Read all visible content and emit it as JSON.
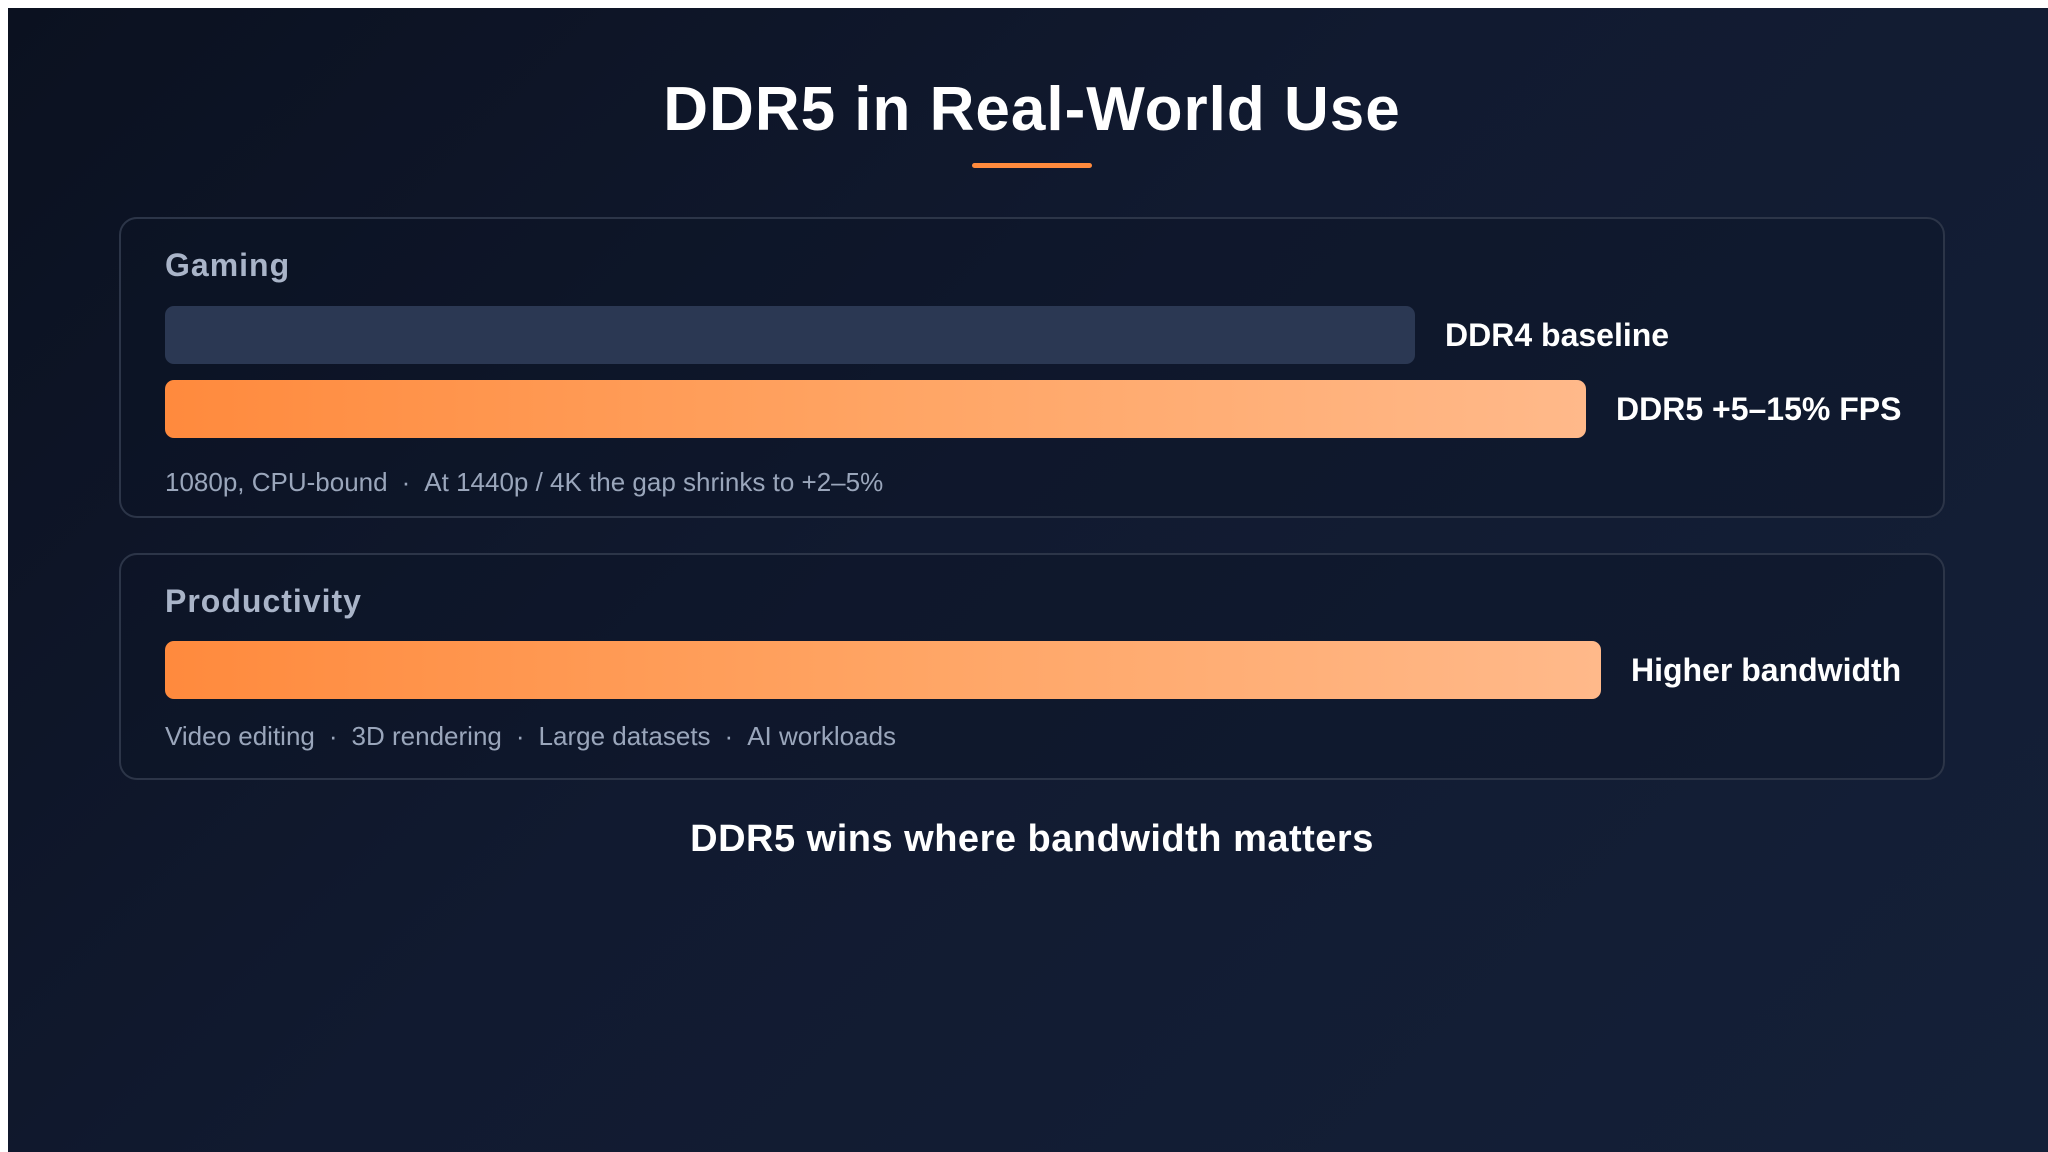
{
  "title": "DDR5 in Real-World Use",
  "tagline": "DDR5 wins where bandwidth matters",
  "colors": {
    "accent": "#ff8a3d",
    "baseline_bar": "#2b3853",
    "background": "#0f172a"
  },
  "gaming": {
    "label": "Gaming",
    "bars": [
      {
        "label": "DDR4 baseline",
        "relative_value": 0.88
      },
      {
        "label": "DDR5 +5–15% FPS",
        "relative_value": 1.0
      }
    ],
    "note": [
      "1080p, CPU-bound",
      "At 1440p / 4K the gap shrinks to +2–5%"
    ]
  },
  "productivity": {
    "label": "Productivity",
    "bars": [
      {
        "label": "Higher bandwidth",
        "relative_value": 1.0
      }
    ],
    "note": [
      "Video editing",
      "3D rendering",
      "Large datasets",
      "AI workloads"
    ]
  },
  "separator": "·"
}
